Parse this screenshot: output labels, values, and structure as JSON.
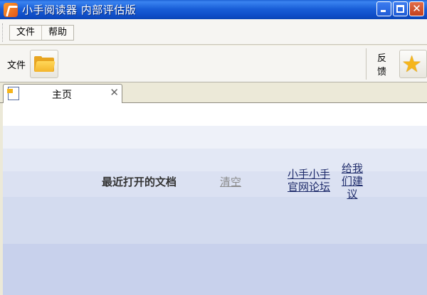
{
  "window": {
    "title": "小手阅读器 内部评估版",
    "accent_color": "#1a5fd8",
    "buttons": [
      "minimize-icon",
      "maximize-icon",
      "close-icon"
    ]
  },
  "menu": {
    "items": [
      {
        "label": "文件"
      },
      {
        "label": "帮助"
      }
    ]
  },
  "toolbar": {
    "file_label": "文件",
    "file_icon": "folder-open-icon",
    "feedback_label": "反馈",
    "feedback_icon": "star-icon"
  },
  "tabs": [
    {
      "label": "主页",
      "icon": "page-icon",
      "close_glyph": "✕"
    }
  ],
  "home": {
    "recent_docs_label": "最近打开的文档",
    "clear_label": "清空",
    "forum_link": "小手小手官网论坛",
    "suggest_link": "给我们建议"
  }
}
